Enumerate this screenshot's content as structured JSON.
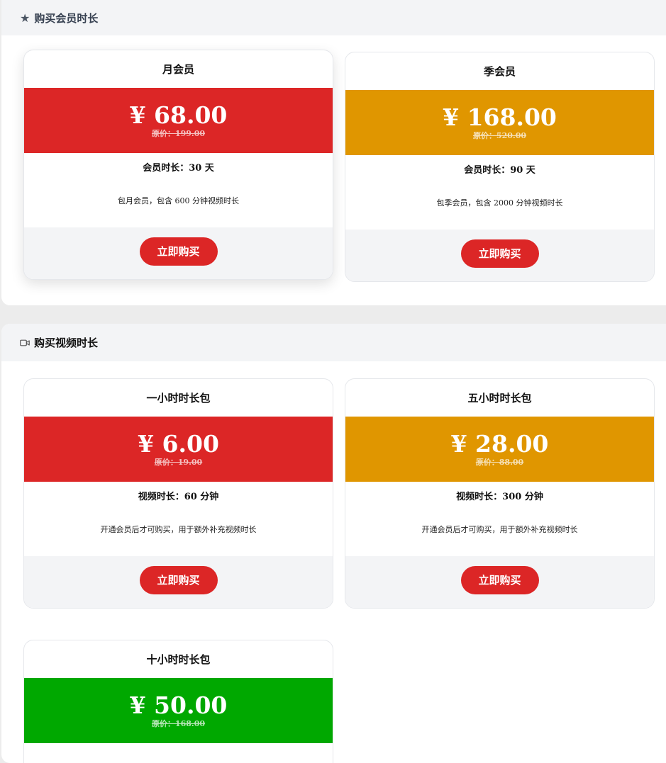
{
  "member_section": {
    "title": "购买会员时长",
    "icon": "star-icon",
    "cards": [
      {
        "title": "月会员",
        "price": "¥ 68.00",
        "original": "原价：199.00",
        "duration": "会员时长：30 天",
        "desc": "包月会员，包含 600 分钟视频时长",
        "button": "立即购买",
        "color": "#dc2626"
      },
      {
        "title": "季会员",
        "price": "¥ 168.00",
        "original": "原价：520.00",
        "duration": "会员时长：90 天",
        "desc": "包季会员，包含 2000 分钟视频时长",
        "button": "立即购买",
        "color": "#e09600"
      }
    ]
  },
  "video_section": {
    "title": "购买视频时长",
    "icon": "video-camera-icon",
    "cards": [
      {
        "title": "一小时时长包",
        "price": "¥ 6.00",
        "original": "原价：19.00",
        "duration": "视频时长：60 分钟",
        "desc": "开通会员后才可购买，用于额外补充视频时长",
        "button": "立即购买",
        "color": "#dc2626"
      },
      {
        "title": "五小时时长包",
        "price": "¥ 28.00",
        "original": "原价：88.00",
        "duration": "视频时长：300 分钟",
        "desc": "开通会员后才可购买，用于额外补充视频时长",
        "button": "立即购买",
        "color": "#e09600"
      },
      {
        "title": "十小时时长包",
        "price": "¥ 50.00",
        "original": "原价：168.00",
        "color": "#00a800"
      }
    ]
  }
}
